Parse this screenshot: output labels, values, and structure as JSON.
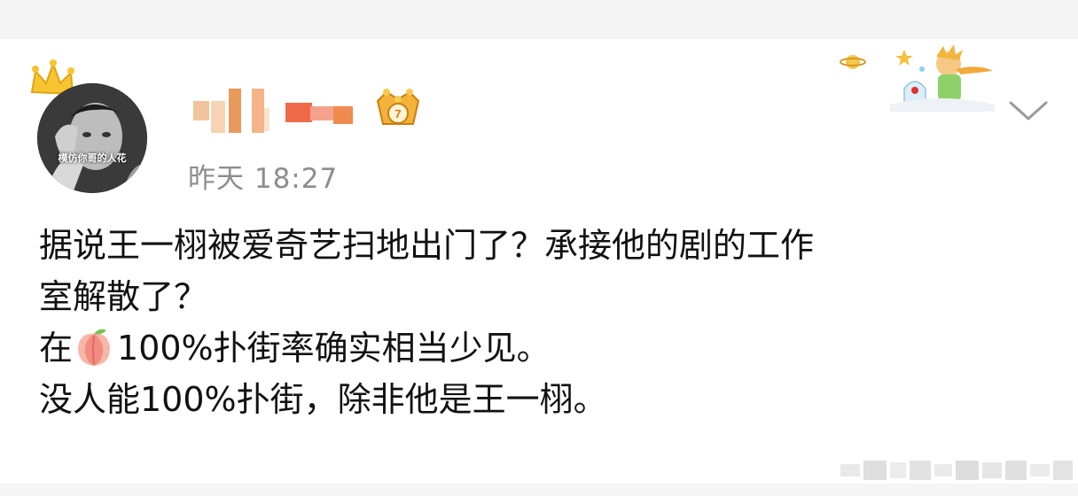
{
  "post": {
    "avatar_caption": "模仿你哥的人花",
    "timestamp": "昨天 18:27",
    "body_lines": [
      "据说王一栩被爱奇艺扫地出门了？承接他的剧的工作",
      "室解散了？",
      "100%扑街率确实相当少见。",
      "没人能100%扑街，除非他是王一栩。"
    ],
    "line3_prefix": "在",
    "icons": {
      "inline_emoji": "peach-emoji-icon",
      "vip_badge": "crown-badge-icon",
      "avatar_decoration": "crown-icon",
      "card_decoration": "little-prince-sticker",
      "menu": "chevron-down-icon"
    }
  },
  "colors": {
    "page_background": "#f3f3f3",
    "card_background": "#ffffff",
    "body_text": "#111111",
    "meta_text": "#8d8d8d",
    "badge_gold": "#e9a21a"
  }
}
